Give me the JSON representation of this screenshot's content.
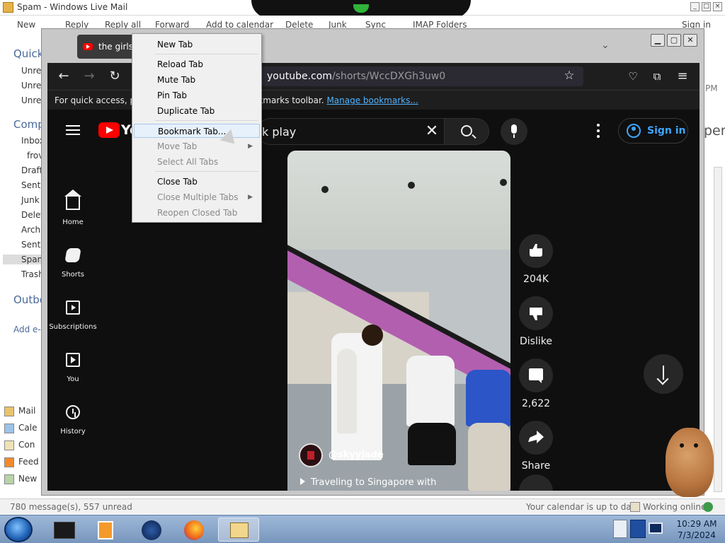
{
  "wlm": {
    "title": "Spam - Windows Live Mail",
    "sign_in": "Sign in",
    "toolbar": [
      "New",
      "Reply",
      "Reply all",
      "Forward",
      "Add to calendar",
      "Delete",
      "Junk",
      "Sync",
      "IMAP Folders"
    ],
    "sidebar": {
      "quick": "Quick",
      "unread": [
        "Unrea",
        "Unrea",
        "Unrea"
      ],
      "comp": "Comp",
      "folders": [
        "Inbox",
        "frov",
        "Draft",
        "Sent",
        "Junk",
        "Delet",
        "Archi",
        "Sent",
        "Spam",
        "Trash"
      ],
      "outbox": "Outbo",
      "add": "Add e-",
      "bottom": [
        "Mail",
        "Cale",
        "Con",
        "Feed",
        "New"
      ]
    },
    "right_text": {
      "pm": "PM",
      "per": "per"
    },
    "status_left": "780 message(s), 557 unread",
    "status_calendar": "Your calendar is up to date",
    "status_online": "Working online"
  },
  "firefox": {
    "tab_title": "the girls n",
    "url_dim": "youtube.com",
    "url_path": "/shorts/WccDXGh3uw0",
    "bookmarks_text_a": "For quick access, plac",
    "bookmarks_text_b": "okmarks toolbar.",
    "bookmarks_link": "Manage bookmarks..."
  },
  "youtube": {
    "logo_text": "Yo",
    "search_value": "k play",
    "sign_in": "Sign in",
    "guide": [
      "Home",
      "Shorts",
      "Subscriptions",
      "You",
      "History"
    ],
    "likes": "204K",
    "dislike": "Dislike",
    "comments": "2,622",
    "share": "Share",
    "channel": "@skyyjade",
    "caption": "Traveling to Singapore with"
  },
  "context_menu": {
    "items": [
      {
        "label": "New Tab",
        "enabled": true
      },
      {
        "label": "Reload Tab",
        "enabled": true
      },
      {
        "label": "Mute Tab",
        "enabled": true
      },
      {
        "label": "Pin Tab",
        "enabled": true
      },
      {
        "label": "Duplicate Tab",
        "enabled": true
      },
      {
        "label": "Bookmark Tab...",
        "enabled": true,
        "highlighted": true
      },
      {
        "label": "Move Tab",
        "enabled": false,
        "submenu": true
      },
      {
        "label": "Select All Tabs",
        "enabled": false
      },
      {
        "label": "Close Tab",
        "enabled": true
      },
      {
        "label": "Close Multiple Tabs",
        "enabled": false,
        "submenu": true
      },
      {
        "label": "Reopen Closed Tab",
        "enabled": false
      }
    ]
  },
  "taskbar": {
    "time": "10:29 AM",
    "date": "7/3/2024"
  }
}
